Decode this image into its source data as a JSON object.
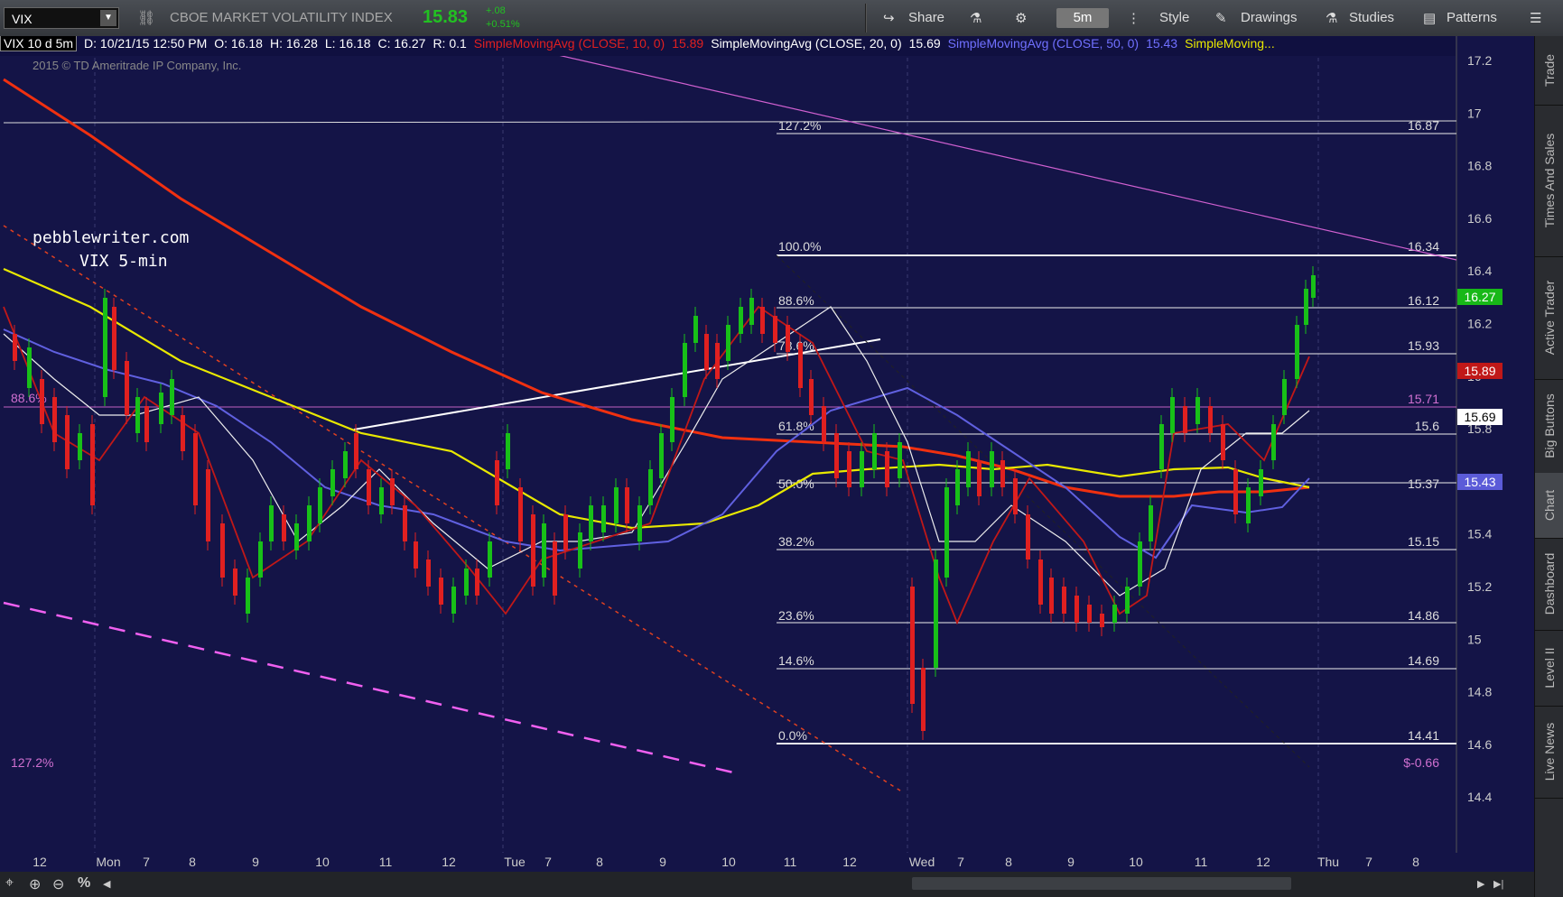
{
  "toolbar": {
    "symbol": "VIX",
    "description": "CBOE MARKET VOLATILITY INDEX",
    "last": "15.83",
    "change": "+.08",
    "change_pct": "+0.51%",
    "share": "Share",
    "timeframe": "5m",
    "style": "Style",
    "drawings": "Drawings",
    "studies": "Studies",
    "patterns": "Patterns"
  },
  "legend": {
    "bar_info": "VIX 10 d 5m",
    "date": "D: 10/21/15 12:50 PM",
    "open": "O: 16.18",
    "high": "H: 16.28",
    "low": "L: 16.18",
    "close": "C: 16.27",
    "range": "R: 0.1",
    "sma10_label": "SimpleMovingAvg (CLOSE, 10, 0)",
    "sma10_value": "15.89",
    "sma20_label": "SimpleMovingAvg (CLOSE, 20, 0)",
    "sma20_value": "15.69",
    "sma50_label": "SimpleMovingAvg (CLOSE, 50, 0)",
    "sma50_value": "15.43",
    "sma_more": "SimpleMoving..."
  },
  "chart_data": {
    "type": "candlestick",
    "copyright": "2015 © TD Ameritrade IP Company, Inc.",
    "annotation_line1": "pebblewriter.com",
    "annotation_line2": "VIX 5-min",
    "y_ticks": [
      "17.2",
      "17",
      "16.8",
      "16.6",
      "16.4",
      "16.2",
      "16",
      "15.8",
      "15.6",
      "15.4",
      "15.2",
      "15",
      "14.8",
      "14.6",
      "14.4"
    ],
    "x_ticks": [
      "12",
      "Mon",
      "7",
      "8",
      "9",
      "10",
      "11",
      "12",
      "Tue",
      "7",
      "8",
      "9",
      "10",
      "11",
      "12",
      "Wed",
      "7",
      "8",
      "9",
      "10",
      "11",
      "12",
      "Thu",
      "7",
      "8"
    ],
    "fib_levels": [
      {
        "pct": "127.2%",
        "price": "$16.87"
      },
      {
        "pct": "100.0%",
        "price": "$16.34"
      },
      {
        "pct": "88.6%",
        "price": "$16.12"
      },
      {
        "pct": "78.6%",
        "price": "$15.93"
      },
      {
        "pct": "61.8%",
        "price": "$15.6"
      },
      {
        "pct": "50.0%",
        "price": "$15.37"
      },
      {
        "pct": "38.2%",
        "price": "$15.15"
      },
      {
        "pct": "23.6%",
        "price": "$14.86"
      },
      {
        "pct": "14.6%",
        "price": "$14.69"
      },
      {
        "pct": "0.0%",
        "price": "$14.41"
      }
    ],
    "left_fib_labels": [
      "88.6%",
      "127.2%"
    ],
    "right_magenta_label": "$15.71",
    "bottom_right_label": "$-0.66",
    "price_markers": [
      {
        "label": "16.27",
        "color": "#18b818"
      },
      {
        "label": "15.89",
        "color": "#c01818"
      },
      {
        "label": "15.69",
        "color": "#ffffff"
      },
      {
        "label": "15.43",
        "color": "#5b5bd8"
      }
    ]
  },
  "sidebar": {
    "tabs": [
      "Trade",
      "Times And Sales",
      "Active Trader",
      "Big Buttons",
      "Chart",
      "Dashboard",
      "Level II",
      "Live News"
    ]
  }
}
